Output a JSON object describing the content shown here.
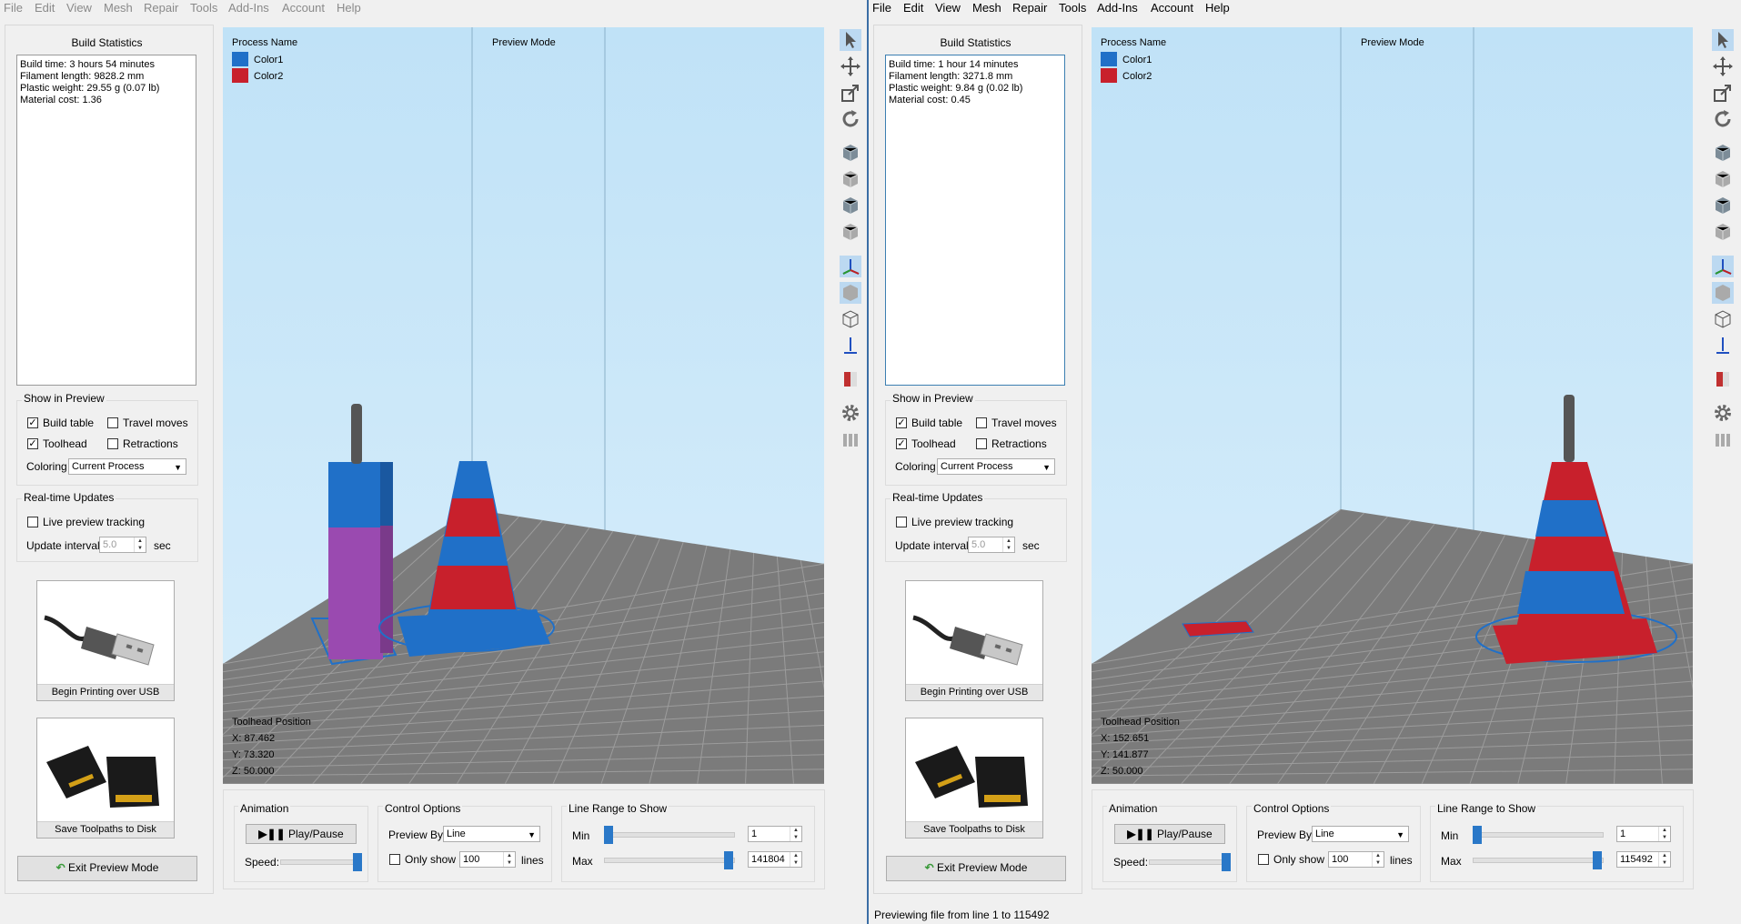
{
  "colors": {
    "color1": "#2070c8",
    "color2": "#c8202c",
    "accent": "#2a78c8",
    "viewport_top": "#c0e2f7"
  },
  "windows": [
    {
      "menu": [
        "File",
        "Edit",
        "View",
        "Mesh",
        "Repair",
        "Tools",
        "Add-Ins",
        "Account",
        "Help"
      ],
      "stats": {
        "title": "Build Statistics",
        "lines": [
          "Build time: 3 hours 54 minutes",
          "Filament length: 9828.2 mm",
          "Plastic weight: 29.55 g (0.07 lb)",
          "Material cost: 1.36"
        ]
      },
      "show_in_preview": {
        "title": "Show in Preview",
        "build_table": "Build table",
        "travel_moves": "Travel moves",
        "toolhead": "Toolhead",
        "retractions": "Retractions",
        "coloring_label": "Coloring",
        "coloring_value": "Current Process"
      },
      "realtime": {
        "title": "Real-time Updates",
        "live_tracking": "Live preview tracking",
        "interval_label": "Update interval",
        "interval_value": "5.0",
        "interval_unit": "sec"
      },
      "usb_button": "Begin Printing over USB",
      "disk_button": "Save Toolpaths to Disk",
      "exit_button": "Exit Preview Mode",
      "viewport": {
        "process_name": "Process Name",
        "preview_mode": "Preview Mode",
        "legend": [
          "Color1",
          "Color2"
        ],
        "toolhead_title": "Toolhead Position",
        "x": "X: 87.462",
        "y": "Y: 73.320",
        "z": "Z: 50.000"
      },
      "animation": {
        "title": "Animation",
        "play": "Play/Pause",
        "speed": "Speed:",
        "speed_level": 1.0
      },
      "control": {
        "title": "Control Options",
        "preview_by": "Preview By",
        "preview_by_value": "Line",
        "only_show": "Only show",
        "only_show_value": "100",
        "lines": "lines"
      },
      "range": {
        "title": "Line Range to Show",
        "min_label": "Min",
        "min_value": "1",
        "max_label": "Max",
        "max_value": "141804"
      }
    },
    {
      "menu": [
        "File",
        "Edit",
        "View",
        "Mesh",
        "Repair",
        "Tools",
        "Add-Ins",
        "Account",
        "Help"
      ],
      "stats": {
        "title": "Build Statistics",
        "lines": [
          "Build time: 1 hour 14 minutes",
          "Filament length: 3271.8 mm",
          "Plastic weight: 9.84 g (0.02 lb)",
          "Material cost: 0.45"
        ]
      },
      "show_in_preview": {
        "title": "Show in Preview",
        "build_table": "Build table",
        "travel_moves": "Travel moves",
        "toolhead": "Toolhead",
        "retractions": "Retractions",
        "coloring_label": "Coloring",
        "coloring_value": "Current Process"
      },
      "realtime": {
        "title": "Real-time Updates",
        "live_tracking": "Live preview tracking",
        "interval_label": "Update interval",
        "interval_value": "5.0",
        "interval_unit": "sec"
      },
      "usb_button": "Begin Printing over USB",
      "disk_button": "Save Toolpaths to Disk",
      "exit_button": "Exit Preview Mode",
      "viewport": {
        "process_name": "Process Name",
        "preview_mode": "Preview Mode",
        "legend": [
          "Color1",
          "Color2"
        ],
        "toolhead_title": "Toolhead Position",
        "x": "X: 152.651",
        "y": "Y: 141.877",
        "z": "Z: 50.000"
      },
      "animation": {
        "title": "Animation",
        "play": "Play/Pause",
        "speed": "Speed:",
        "speed_level": 1.0
      },
      "control": {
        "title": "Control Options",
        "preview_by": "Preview By",
        "preview_by_value": "Line",
        "only_show": "Only show",
        "only_show_value": "100",
        "lines": "lines"
      },
      "range": {
        "title": "Line Range to Show",
        "min_label": "Min",
        "min_value": "1",
        "max_label": "Max",
        "max_value": "115492"
      },
      "status": "Previewing file from line 1 to 115492"
    }
  ]
}
